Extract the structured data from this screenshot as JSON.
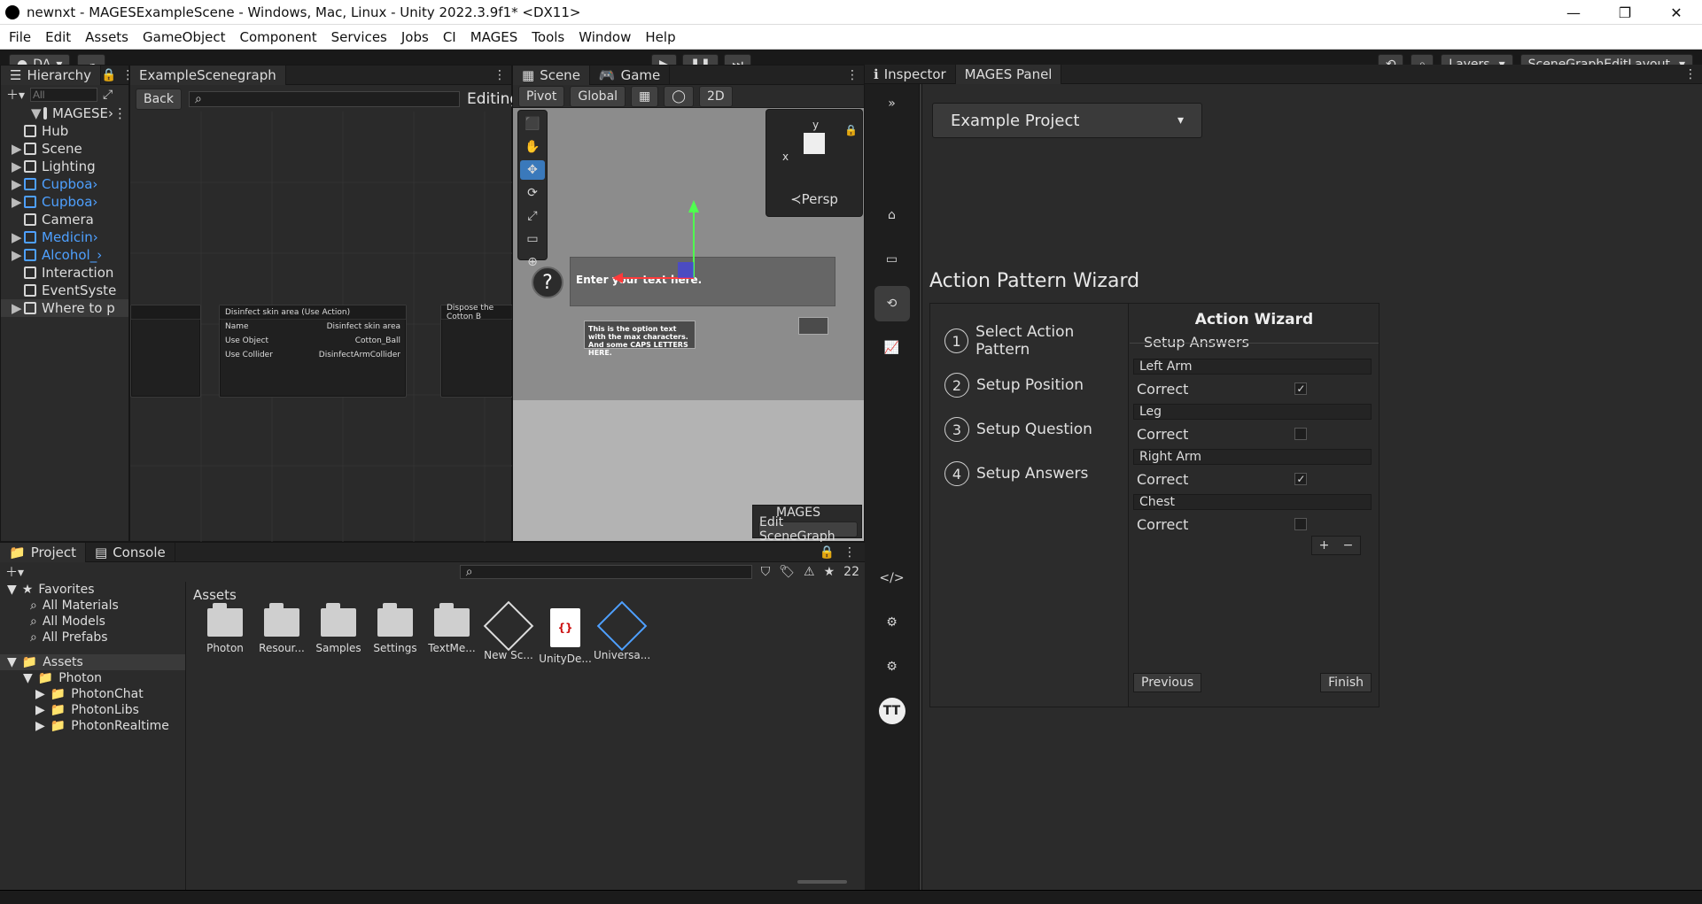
{
  "window": {
    "title": "newnxt - MAGESExampleScene - Windows, Mac, Linux - Unity 2022.3.9f1* <DX11>"
  },
  "menu": [
    "File",
    "Edit",
    "Assets",
    "GameObject",
    "Component",
    "Services",
    "Jobs",
    "CI",
    "MAGES",
    "Tools",
    "Window",
    "Help"
  ],
  "toolbar": {
    "account": "DA",
    "layers": "Layers",
    "layout": "SceneGraphEditLayout"
  },
  "hierarchy": {
    "tab": "Hierarchy",
    "search_placeholder": "All",
    "root": "MAGESE›",
    "items": [
      {
        "label": "Hub",
        "blue": false,
        "arrow": ""
      },
      {
        "label": "Scene",
        "blue": false,
        "arrow": "▶"
      },
      {
        "label": "Lighting",
        "blue": false,
        "arrow": "▶"
      },
      {
        "label": "Cupboa›",
        "blue": true,
        "arrow": "▶"
      },
      {
        "label": "Cupboa›",
        "blue": true,
        "arrow": "▶"
      },
      {
        "label": "Camera",
        "blue": false,
        "arrow": ""
      },
      {
        "label": "Medicin›",
        "blue": true,
        "arrow": "▶"
      },
      {
        "label": "Alcohol_›",
        "blue": true,
        "arrow": "▶"
      },
      {
        "label": "Interaction",
        "blue": false,
        "arrow": ""
      },
      {
        "label": "EventSyste",
        "blue": false,
        "arrow": ""
      },
      {
        "label": "Where to p",
        "blue": false,
        "arrow": "▶"
      }
    ]
  },
  "scenegraph": {
    "tab": "ExampleScenegraph",
    "back": "Back",
    "editing": "Editing",
    "nodes": [
      {
        "title": "Disinfect skin area (Use Action)",
        "name": "Disinfect skin area",
        "use_object": "Cotton_Ball",
        "use_collider": "DisinfectArmCollider"
      },
      {
        "title": "Dispose the Cotton B"
      }
    ]
  },
  "scene": {
    "tab_scene": "Scene",
    "tab_game": "Game",
    "pivot": "Pivot",
    "global": "Global",
    "two_d": "2D",
    "persp": "≺Persp",
    "enter_text": "Enter your text here.",
    "option_text": "This is the option text with the max characters. And some CAPS LETTERS HERE.",
    "mages_label": "MAGES",
    "edit_scenegraph": "Edit SceneGraph"
  },
  "mages_panel": {
    "tab_inspector": "Inspector",
    "tab_mages": "MAGES Panel",
    "project": "Example Project",
    "title": "Action Pattern Wizard",
    "wizard_title": "Action Wizard",
    "steps": [
      {
        "num": "1",
        "label": "Select Action Pattern"
      },
      {
        "num": "2",
        "label": "Setup Position"
      },
      {
        "num": "3",
        "label": "Setup Question"
      },
      {
        "num": "4",
        "label": "Setup Answers"
      }
    ],
    "setup_answers_label": "Setup Answers",
    "answers": [
      {
        "name": "Left Arm",
        "correct": true
      },
      {
        "name": "Leg",
        "correct": false
      },
      {
        "name": "Right Arm",
        "correct": true
      },
      {
        "name": "Chest",
        "correct": false
      }
    ],
    "correct_label": "Correct",
    "previous": "Previous",
    "finish": "Finish",
    "side_initials": "TT"
  },
  "project": {
    "tab_project": "Project",
    "tab_console": "Console",
    "favorites": "Favorites",
    "fav_items": [
      "All Materials",
      "All Models",
      "All Prefabs"
    ],
    "assets_label": "Assets",
    "tree": [
      "Photon",
      "PhotonChat",
      "PhotonLibs",
      "PhotonRealtime"
    ],
    "assets_header": "Assets",
    "asset_items": [
      "Photon",
      "Resour...",
      "Samples",
      "Settings",
      "TextMe...",
      "New Sc...",
      "UnityDe...",
      "Universa..."
    ],
    "hidden_count": "22"
  }
}
